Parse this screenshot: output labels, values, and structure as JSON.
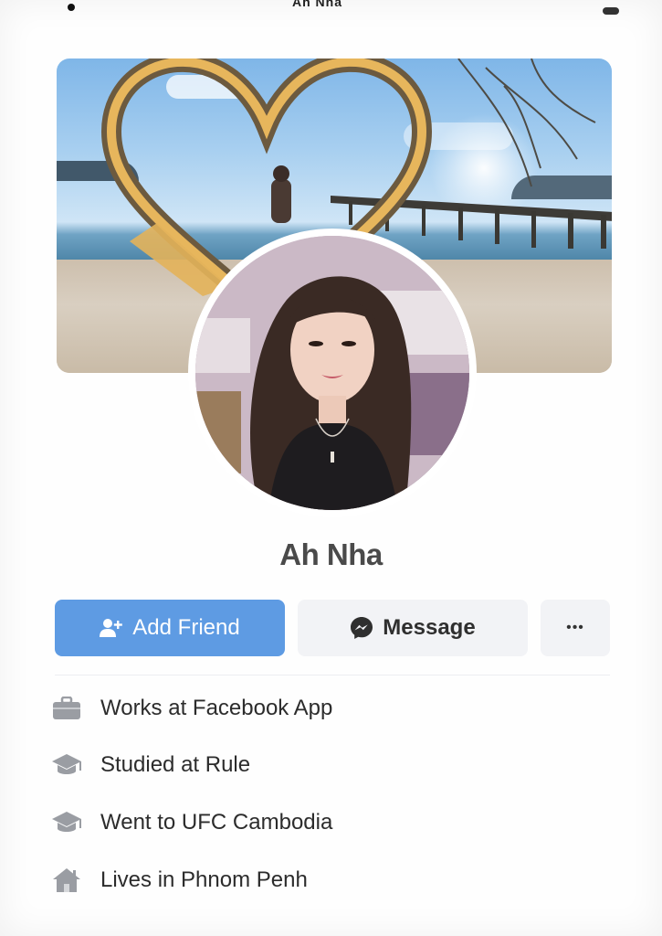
{
  "header": {
    "title": "Ah Nha"
  },
  "profile": {
    "name": "Ah Nha"
  },
  "actions": {
    "add_friend_label": "Add Friend",
    "message_label": "Message",
    "more_label": "•••"
  },
  "intro": [
    {
      "icon": "briefcase-icon",
      "text": "Works at Facebook App"
    },
    {
      "icon": "graduation-cap-icon",
      "text": "Studied at Rule"
    },
    {
      "icon": "graduation-cap-icon",
      "text": "Went to UFC Cambodia"
    },
    {
      "icon": "house-icon",
      "text": "Lives in Phnom Penh"
    }
  ],
  "colors": {
    "primary": "#5e9be3",
    "secondary_button": "#f2f3f6",
    "text": "#2c2c2c",
    "icon": "#9a9da3"
  }
}
